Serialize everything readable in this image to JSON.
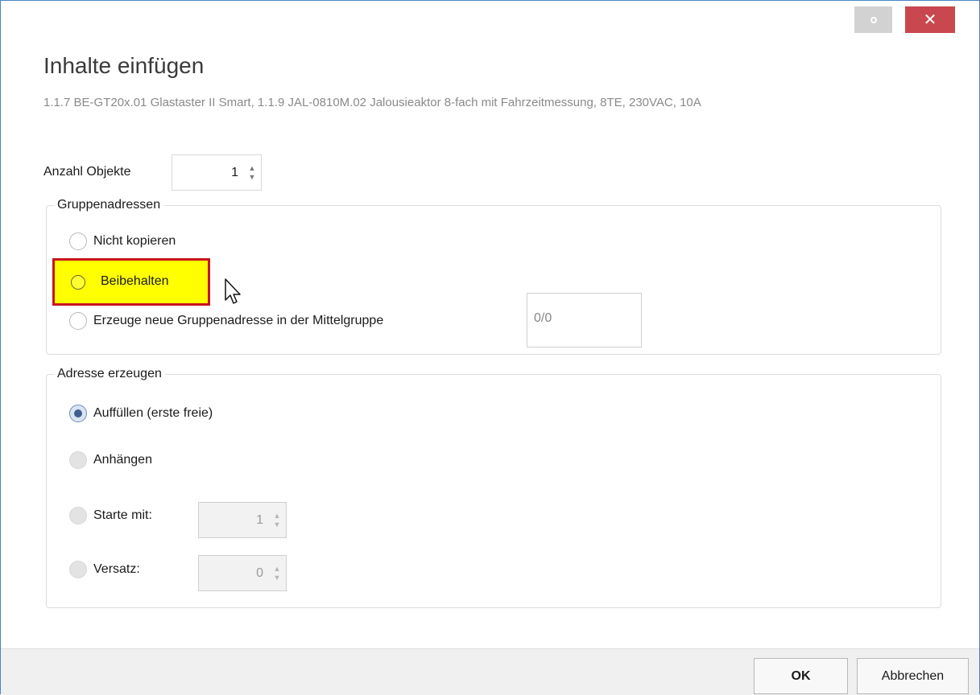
{
  "window": {
    "settings_icon": "settings-icon",
    "close_icon": "close-icon",
    "close_glyph": "✕",
    "close_color": "#c9474e"
  },
  "dialog": {
    "title": "Inhalte einfügen",
    "subtitle": "1.1.7 BE-GT20x.01 Glastaster II Smart, 1.1.9 JAL-0810M.02 Jalousieaktor 8-fach mit Fahrzeitmessung, 8TE, 230VAC, 10A"
  },
  "object_count": {
    "label": "Anzahl Objekte",
    "value": "1"
  },
  "group_addresses": {
    "legend": "Gruppenadressen",
    "options": [
      {
        "label": "Nicht kopieren",
        "selected": false
      },
      {
        "label": "Beibehalten",
        "selected": false,
        "highlighted": true
      },
      {
        "label": "Erzeuge neue Gruppenadresse in der Mittelgruppe",
        "selected": false
      }
    ],
    "middle_group_value": "0/0",
    "highlight_color": "#ffff00",
    "highlight_border_color": "#c5151c"
  },
  "address_generation": {
    "legend": "Adresse erzeugen",
    "options": [
      {
        "label": "Auffüllen (erste freie)",
        "selected": true
      },
      {
        "label": "Anhängen",
        "selected": false
      },
      {
        "label": "Starte mit:",
        "selected": false
      },
      {
        "label": "Versatz:",
        "selected": false
      }
    ],
    "start_value": "1",
    "offset_value": "0"
  },
  "footer": {
    "ok_label": "OK",
    "cancel_label": "Abbrechen"
  }
}
